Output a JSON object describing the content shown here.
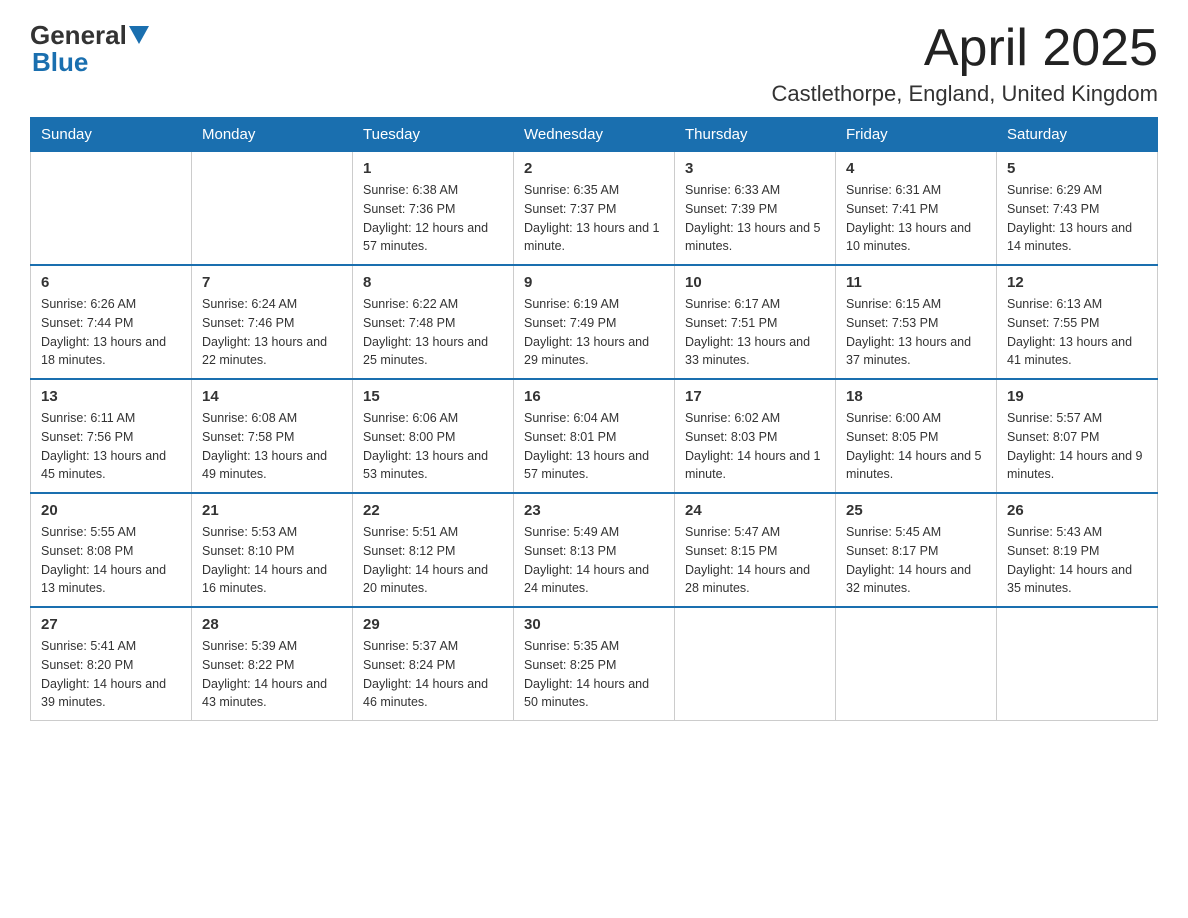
{
  "header": {
    "logo_general": "General",
    "logo_blue": "Blue",
    "month_title": "April 2025",
    "location": "Castlethorpe, England, United Kingdom"
  },
  "days_of_week": [
    "Sunday",
    "Monday",
    "Tuesday",
    "Wednesday",
    "Thursday",
    "Friday",
    "Saturday"
  ],
  "weeks": [
    [
      {
        "day": "",
        "sunrise": "",
        "sunset": "",
        "daylight": ""
      },
      {
        "day": "",
        "sunrise": "",
        "sunset": "",
        "daylight": ""
      },
      {
        "day": "1",
        "sunrise": "Sunrise: 6:38 AM",
        "sunset": "Sunset: 7:36 PM",
        "daylight": "Daylight: 12 hours and 57 minutes."
      },
      {
        "day": "2",
        "sunrise": "Sunrise: 6:35 AM",
        "sunset": "Sunset: 7:37 PM",
        "daylight": "Daylight: 13 hours and 1 minute."
      },
      {
        "day": "3",
        "sunrise": "Sunrise: 6:33 AM",
        "sunset": "Sunset: 7:39 PM",
        "daylight": "Daylight: 13 hours and 5 minutes."
      },
      {
        "day": "4",
        "sunrise": "Sunrise: 6:31 AM",
        "sunset": "Sunset: 7:41 PM",
        "daylight": "Daylight: 13 hours and 10 minutes."
      },
      {
        "day": "5",
        "sunrise": "Sunrise: 6:29 AM",
        "sunset": "Sunset: 7:43 PM",
        "daylight": "Daylight: 13 hours and 14 minutes."
      }
    ],
    [
      {
        "day": "6",
        "sunrise": "Sunrise: 6:26 AM",
        "sunset": "Sunset: 7:44 PM",
        "daylight": "Daylight: 13 hours and 18 minutes."
      },
      {
        "day": "7",
        "sunrise": "Sunrise: 6:24 AM",
        "sunset": "Sunset: 7:46 PM",
        "daylight": "Daylight: 13 hours and 22 minutes."
      },
      {
        "day": "8",
        "sunrise": "Sunrise: 6:22 AM",
        "sunset": "Sunset: 7:48 PM",
        "daylight": "Daylight: 13 hours and 25 minutes."
      },
      {
        "day": "9",
        "sunrise": "Sunrise: 6:19 AM",
        "sunset": "Sunset: 7:49 PM",
        "daylight": "Daylight: 13 hours and 29 minutes."
      },
      {
        "day": "10",
        "sunrise": "Sunrise: 6:17 AM",
        "sunset": "Sunset: 7:51 PM",
        "daylight": "Daylight: 13 hours and 33 minutes."
      },
      {
        "day": "11",
        "sunrise": "Sunrise: 6:15 AM",
        "sunset": "Sunset: 7:53 PM",
        "daylight": "Daylight: 13 hours and 37 minutes."
      },
      {
        "day": "12",
        "sunrise": "Sunrise: 6:13 AM",
        "sunset": "Sunset: 7:55 PM",
        "daylight": "Daylight: 13 hours and 41 minutes."
      }
    ],
    [
      {
        "day": "13",
        "sunrise": "Sunrise: 6:11 AM",
        "sunset": "Sunset: 7:56 PM",
        "daylight": "Daylight: 13 hours and 45 minutes."
      },
      {
        "day": "14",
        "sunrise": "Sunrise: 6:08 AM",
        "sunset": "Sunset: 7:58 PM",
        "daylight": "Daylight: 13 hours and 49 minutes."
      },
      {
        "day": "15",
        "sunrise": "Sunrise: 6:06 AM",
        "sunset": "Sunset: 8:00 PM",
        "daylight": "Daylight: 13 hours and 53 minutes."
      },
      {
        "day": "16",
        "sunrise": "Sunrise: 6:04 AM",
        "sunset": "Sunset: 8:01 PM",
        "daylight": "Daylight: 13 hours and 57 minutes."
      },
      {
        "day": "17",
        "sunrise": "Sunrise: 6:02 AM",
        "sunset": "Sunset: 8:03 PM",
        "daylight": "Daylight: 14 hours and 1 minute."
      },
      {
        "day": "18",
        "sunrise": "Sunrise: 6:00 AM",
        "sunset": "Sunset: 8:05 PM",
        "daylight": "Daylight: 14 hours and 5 minutes."
      },
      {
        "day": "19",
        "sunrise": "Sunrise: 5:57 AM",
        "sunset": "Sunset: 8:07 PM",
        "daylight": "Daylight: 14 hours and 9 minutes."
      }
    ],
    [
      {
        "day": "20",
        "sunrise": "Sunrise: 5:55 AM",
        "sunset": "Sunset: 8:08 PM",
        "daylight": "Daylight: 14 hours and 13 minutes."
      },
      {
        "day": "21",
        "sunrise": "Sunrise: 5:53 AM",
        "sunset": "Sunset: 8:10 PM",
        "daylight": "Daylight: 14 hours and 16 minutes."
      },
      {
        "day": "22",
        "sunrise": "Sunrise: 5:51 AM",
        "sunset": "Sunset: 8:12 PM",
        "daylight": "Daylight: 14 hours and 20 minutes."
      },
      {
        "day": "23",
        "sunrise": "Sunrise: 5:49 AM",
        "sunset": "Sunset: 8:13 PM",
        "daylight": "Daylight: 14 hours and 24 minutes."
      },
      {
        "day": "24",
        "sunrise": "Sunrise: 5:47 AM",
        "sunset": "Sunset: 8:15 PM",
        "daylight": "Daylight: 14 hours and 28 minutes."
      },
      {
        "day": "25",
        "sunrise": "Sunrise: 5:45 AM",
        "sunset": "Sunset: 8:17 PM",
        "daylight": "Daylight: 14 hours and 32 minutes."
      },
      {
        "day": "26",
        "sunrise": "Sunrise: 5:43 AM",
        "sunset": "Sunset: 8:19 PM",
        "daylight": "Daylight: 14 hours and 35 minutes."
      }
    ],
    [
      {
        "day": "27",
        "sunrise": "Sunrise: 5:41 AM",
        "sunset": "Sunset: 8:20 PM",
        "daylight": "Daylight: 14 hours and 39 minutes."
      },
      {
        "day": "28",
        "sunrise": "Sunrise: 5:39 AM",
        "sunset": "Sunset: 8:22 PM",
        "daylight": "Daylight: 14 hours and 43 minutes."
      },
      {
        "day": "29",
        "sunrise": "Sunrise: 5:37 AM",
        "sunset": "Sunset: 8:24 PM",
        "daylight": "Daylight: 14 hours and 46 minutes."
      },
      {
        "day": "30",
        "sunrise": "Sunrise: 5:35 AM",
        "sunset": "Sunset: 8:25 PM",
        "daylight": "Daylight: 14 hours and 50 minutes."
      },
      {
        "day": "",
        "sunrise": "",
        "sunset": "",
        "daylight": ""
      },
      {
        "day": "",
        "sunrise": "",
        "sunset": "",
        "daylight": ""
      },
      {
        "day": "",
        "sunrise": "",
        "sunset": "",
        "daylight": ""
      }
    ]
  ]
}
